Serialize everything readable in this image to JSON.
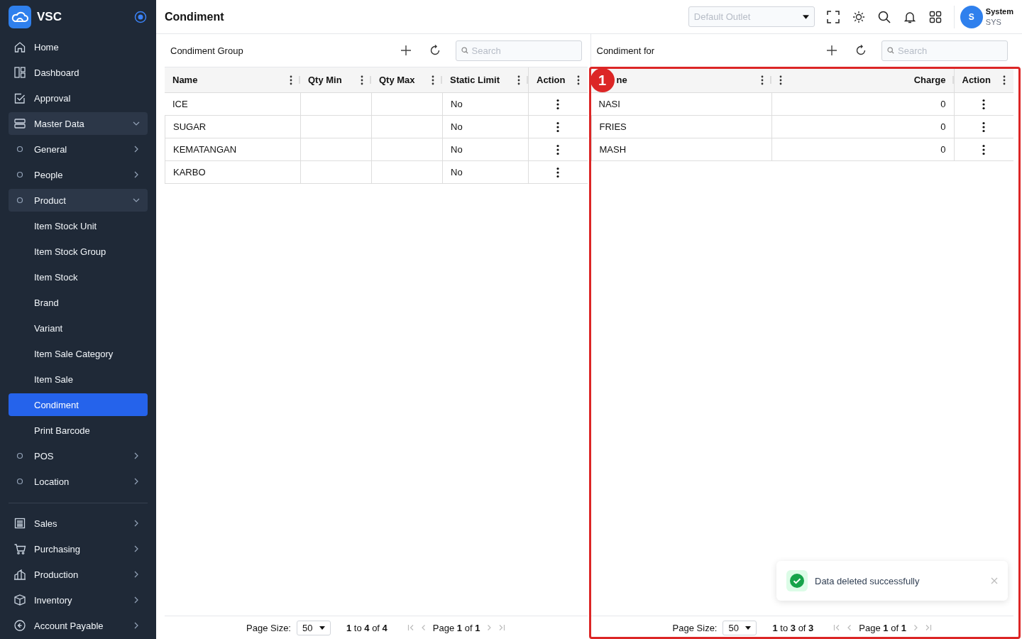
{
  "brand": {
    "name": "VSC"
  },
  "sidebar": {
    "sections": [
      [
        {
          "label": "Home",
          "kind": "top",
          "selected": false
        },
        {
          "label": "Dashboard",
          "kind": "top",
          "selected": false
        },
        {
          "label": "Approval",
          "kind": "top",
          "selected": false
        },
        {
          "label": "Master Data",
          "kind": "top",
          "selected": false,
          "expanded": true,
          "children": [
            {
              "label": "General",
              "kind": "sub",
              "selected": false,
              "expanded": false
            },
            {
              "label": "People",
              "kind": "sub",
              "selected": false,
              "expanded": false
            },
            {
              "label": "Product",
              "kind": "sub",
              "selected": false,
              "expanded": true,
              "children": [
                {
                  "label": "Item Stock Unit",
                  "kind": "leaf",
                  "selected": false
                },
                {
                  "label": "Item Stock Group",
                  "kind": "leaf",
                  "selected": false
                },
                {
                  "label": "Item Stock",
                  "kind": "leaf",
                  "selected": false
                },
                {
                  "label": "Brand",
                  "kind": "leaf",
                  "selected": false
                },
                {
                  "label": "Variant",
                  "kind": "leaf",
                  "selected": false
                },
                {
                  "label": "Item Sale Category",
                  "kind": "leaf",
                  "selected": false
                },
                {
                  "label": "Item Sale",
                  "kind": "leaf",
                  "selected": false
                },
                {
                  "label": "Condiment",
                  "kind": "leaf",
                  "selected": true
                },
                {
                  "label": "Print Barcode",
                  "kind": "leaf",
                  "selected": false
                }
              ]
            },
            {
              "label": "POS",
              "kind": "sub",
              "selected": false,
              "expanded": false
            },
            {
              "label": "Location",
              "kind": "sub",
              "selected": false,
              "expanded": false
            }
          ]
        }
      ],
      [
        {
          "label": "Sales",
          "kind": "top",
          "selected": false,
          "expanded": false
        },
        {
          "label": "Purchasing",
          "kind": "top",
          "selected": false,
          "expanded": false
        },
        {
          "label": "Production",
          "kind": "top",
          "selected": false,
          "expanded": false
        },
        {
          "label": "Inventory",
          "kind": "top",
          "selected": false,
          "expanded": false
        },
        {
          "label": "Account Payable",
          "kind": "top",
          "selected": false,
          "expanded": false
        }
      ]
    ]
  },
  "header": {
    "title": "Condiment",
    "outlet_select": {
      "placeholder": "Default Outlet"
    },
    "user": {
      "initial": "S",
      "name": "System",
      "code": "SYS"
    }
  },
  "panels": [
    {
      "title": "Condiment Group",
      "search": {
        "placeholder": "Search"
      },
      "columns": [
        {
          "label": "Name",
          "kind": "text"
        },
        {
          "label": "Qty Min",
          "kind": "text"
        },
        {
          "label": "Qty Max",
          "kind": "text"
        },
        {
          "label": "Static Limit",
          "kind": "text"
        }
      ],
      "action_column": "Action",
      "rows": [
        [
          "ICE",
          null,
          null,
          "No"
        ],
        [
          "SUGAR",
          null,
          null,
          "No"
        ],
        [
          "KEMATANGAN",
          null,
          null,
          "No"
        ],
        [
          "KARBO",
          null,
          null,
          "No"
        ]
      ],
      "pagination": {
        "page_size_label": "Page Size:",
        "page_size": "50",
        "range": "**1** to **4** of **4**",
        "page": "Page **1** of **1**"
      }
    },
    {
      "title": "Condiment for",
      "search": {
        "placeholder": "Search"
      },
      "columns": [
        {
          "label": "ne",
          "kind": "text"
        },
        {
          "label": "Charge",
          "kind": "number"
        }
      ],
      "action_column": "Action",
      "rows": [
        [
          "NASI",
          "0"
        ],
        [
          "FRIES",
          "0"
        ],
        [
          "MASH",
          "0"
        ]
      ],
      "pagination": {
        "page_size_label": "Page Size:",
        "page_size": "50",
        "range": "**1** to **3** of **3**",
        "page": "Page **1** of **1**"
      },
      "annotation": {
        "label": "1"
      }
    }
  ],
  "toast": {
    "kind": "success",
    "message": "Data deleted successfully"
  }
}
